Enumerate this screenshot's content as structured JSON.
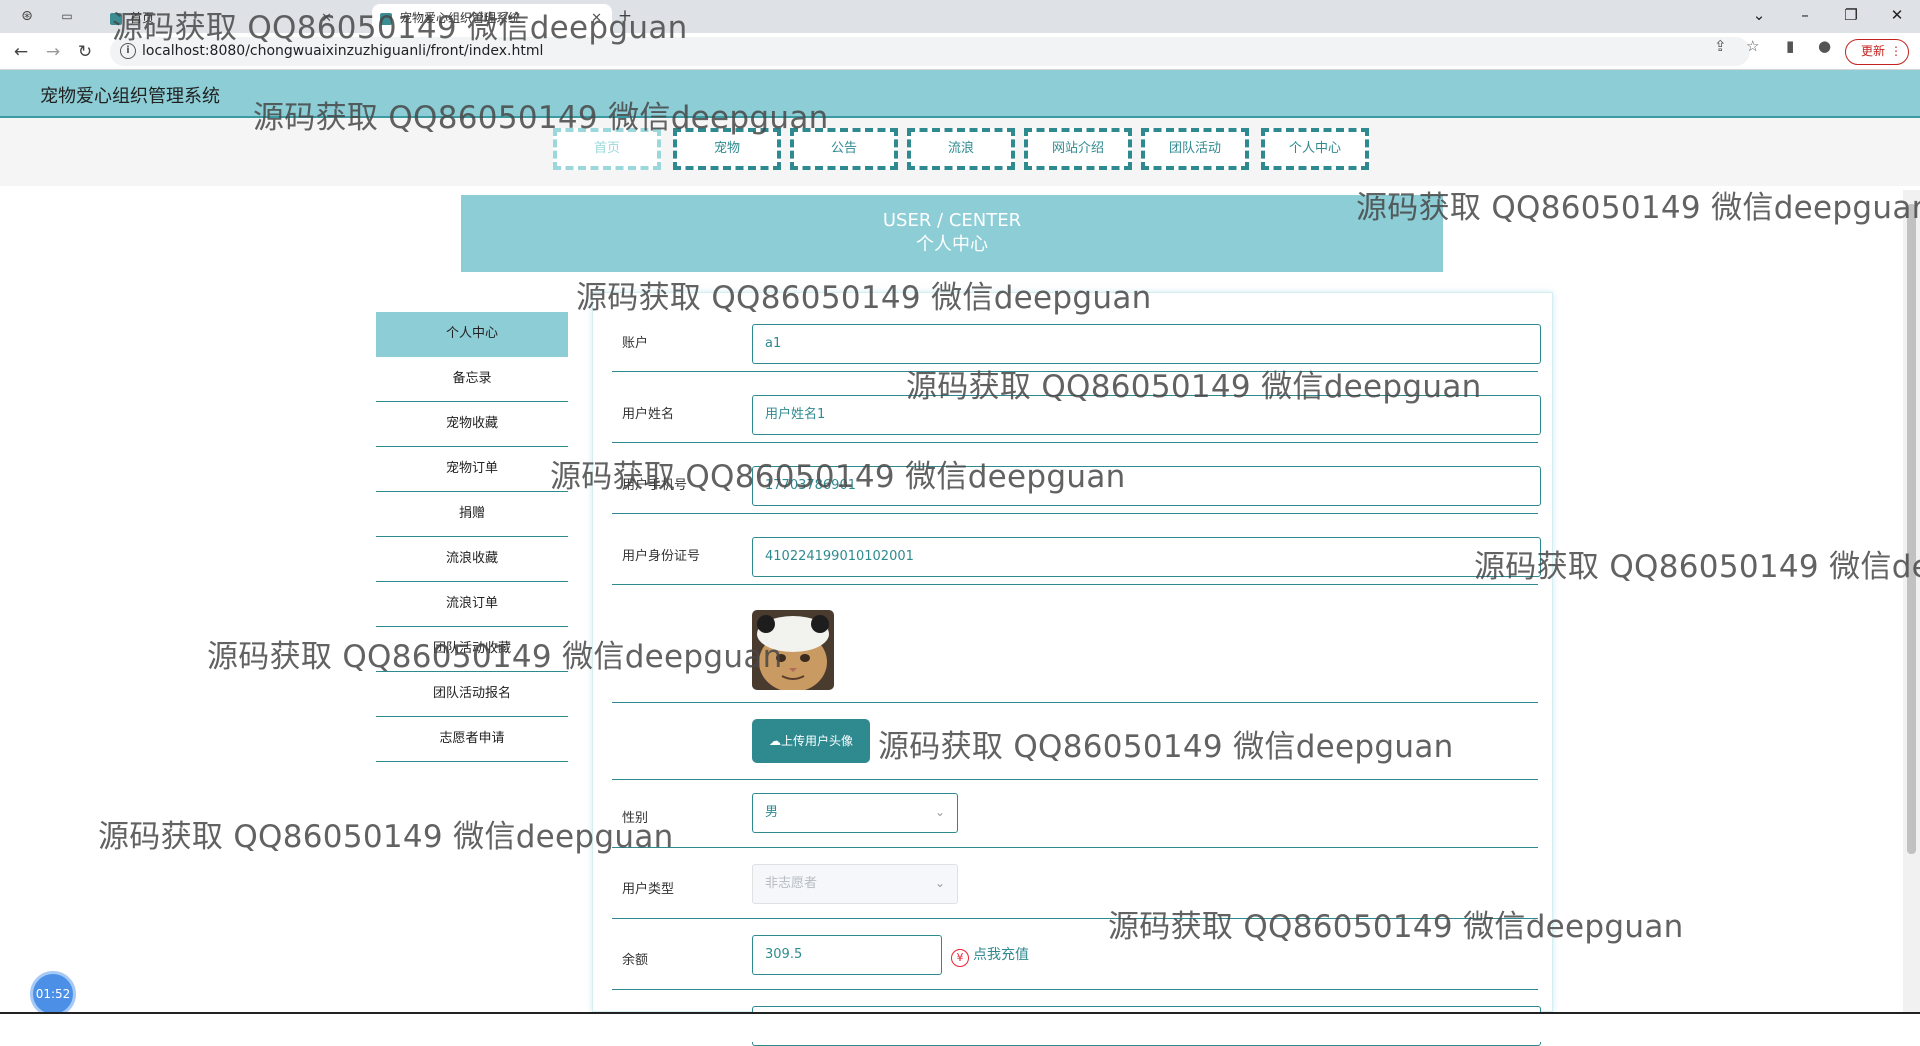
{
  "browser": {
    "tabs": [
      {
        "label": "首页"
      },
      {
        "label": "宠物爱心组织管理系统"
      }
    ],
    "url": "localhost:8080/chongwuaixinzuzhiguanli/front/index.html",
    "update_label": "更新"
  },
  "site": {
    "title": "宠物爱心组织管理系统",
    "nav": [
      "首页",
      "宠物",
      "公告",
      "流浪",
      "网站介绍",
      "团队活动",
      "个人中心"
    ]
  },
  "banner": {
    "en": "USER / CENTER",
    "zh": "个人中心"
  },
  "sidebar": {
    "items": [
      "个人中心",
      "备忘录",
      "宠物收藏",
      "宠物订单",
      "捐赠",
      "流浪收藏",
      "流浪订单",
      "团队活动收藏",
      "团队活动报名",
      "志愿者申请"
    ]
  },
  "form": {
    "account": {
      "label": "账户",
      "value": "a1"
    },
    "name": {
      "label": "用户姓名",
      "value": "用户姓名1"
    },
    "phone": {
      "label": "用户手机号",
      "value": "17703786901"
    },
    "idcard": {
      "label": "用户身份证号",
      "value": "410224199010102001"
    },
    "upload_label": "上传用户头像",
    "gender": {
      "label": "性别",
      "value": "男"
    },
    "user_type": {
      "label": "用户类型",
      "value": "非志愿者"
    },
    "balance": {
      "label": "余额",
      "value": "309.5",
      "recharge_label": "点我充值"
    }
  },
  "timer": "01:52",
  "watermark": "源码获取 QQ86050149 微信deepguan",
  "colors": {
    "accent": "#8ccdd6",
    "primary": "#2f8a90"
  }
}
